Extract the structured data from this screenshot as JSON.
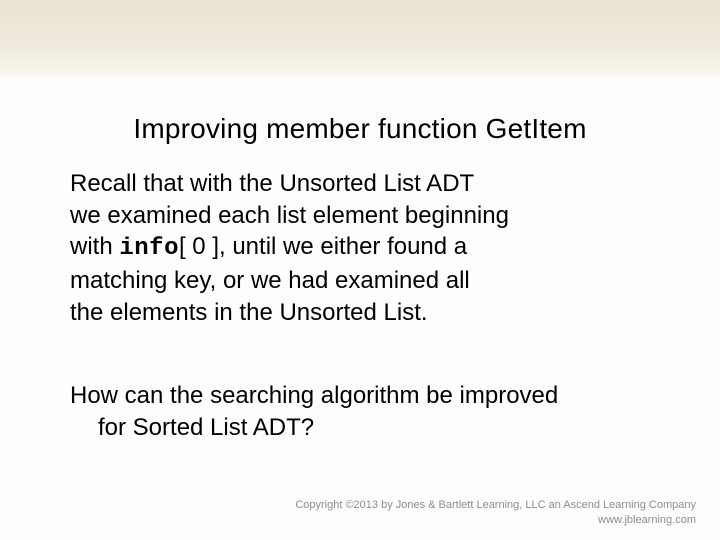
{
  "slide": {
    "title": "Improving member function GetItem",
    "para_l1": "Recall that with the Unsorted List ADT",
    "para_l2": "we examined each list element beginning",
    "para_l3a": "with ",
    "para_l3_code": "info",
    "para_l3b": "[ 0 ], until we either found a",
    "para_l4": "matching key, or we had examined all",
    "para_l5": "the elements in the Unsorted List.",
    "question_l1": "How can the searching algorithm be improved",
    "question_l2": "for Sorted List ADT?"
  },
  "footer": {
    "copyright": "Copyright ©2013 by Jones & Bartlett Learning, LLC an Ascend Learning Company",
    "url": "www.jblearning.com"
  }
}
